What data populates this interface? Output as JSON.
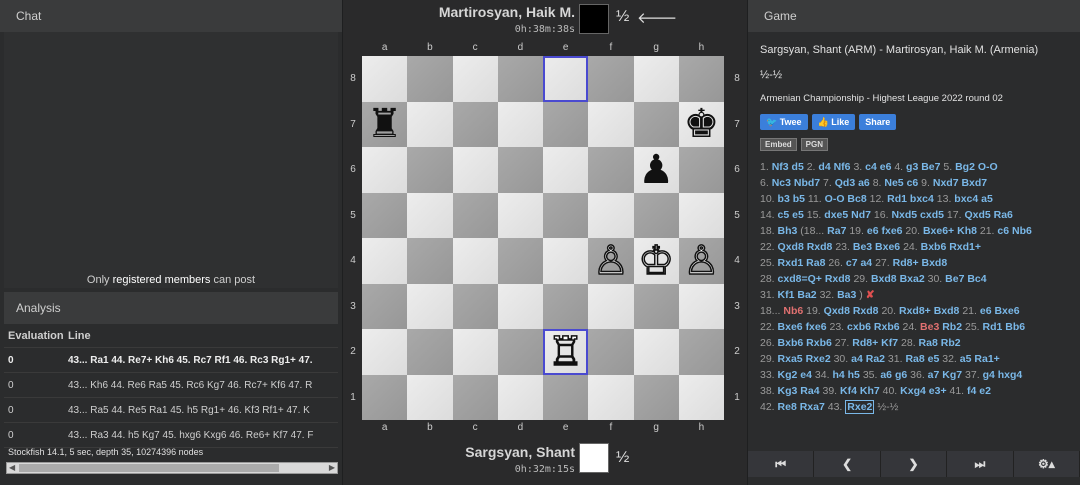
{
  "chat": {
    "title": "Chat",
    "note_prefix": "Only ",
    "note_link": "registered members",
    "note_suffix": " can post"
  },
  "analysis": {
    "title": "Analysis",
    "col_eval": "Evaluation",
    "col_line": "Line",
    "rows": [
      {
        "eval": "0",
        "line": "43... Ra1 44. Re7+ Kh6 45. Rc7 Rf1 46. Rc3 Rg1+ 47."
      },
      {
        "eval": "0",
        "line": "43... Kh6 44. Re6 Ra5 45. Rc6 Kg7 46. Rc7+ Kf6 47. R"
      },
      {
        "eval": "0",
        "line": "43... Ra5 44. Re5 Ra1 45. h5 Rg1+ 46. Kf3 Rf1+ 47. K"
      },
      {
        "eval": "0",
        "line": "43... Ra3 44. h5 Kg7 45. hxg6 Kxg6 46. Re6+ Kf7 47. F"
      }
    ],
    "engine_name": "Stockfish 14.1",
    "engine_info": ", 5 sec, depth 35, 10274396 nodes"
  },
  "top_player": {
    "name": "Martirosyan, Haik M.",
    "time": "0h:38m:38s",
    "score": "½",
    "arrow": "🡐",
    "color": "#000000"
  },
  "bottom_player": {
    "name": "Sargsyan, Shant",
    "time": "0h:32m:15s",
    "score": "½",
    "color": "#ffffff"
  },
  "board": {
    "files": [
      "a",
      "b",
      "c",
      "d",
      "e",
      "f",
      "g",
      "h"
    ],
    "ranks": [
      "8",
      "7",
      "6",
      "5",
      "4",
      "3",
      "2",
      "1"
    ],
    "pieces": {
      "a7": {
        "glyph": "♜",
        "side": "b"
      },
      "h7": {
        "glyph": "♚",
        "side": "b"
      },
      "g6": {
        "glyph": "♟",
        "side": "b"
      },
      "f4": {
        "glyph": "♙",
        "side": "w"
      },
      "g4": {
        "glyph": "♔",
        "side": "w"
      },
      "h4": {
        "glyph": "♙",
        "side": "w"
      },
      "e2": {
        "glyph": "♖",
        "side": "w"
      }
    },
    "highlight": [
      "e8",
      "e2"
    ]
  },
  "game": {
    "title": "Game",
    "players": "Sargsyan, Shant (ARM) - Martirosyan, Haik M. (Armenia)",
    "result": "½-½",
    "event": "Armenian Championship - Highest League 2022 round 02",
    "tweet": "Twee",
    "like": "Like",
    "share": "Share",
    "embed": "Embed",
    "pgn": "PGN",
    "move_lines": [
      [
        [
          "n",
          "1."
        ],
        [
          "m",
          "Nf3"
        ],
        [
          "m",
          "d5"
        ],
        [
          "n",
          "2."
        ],
        [
          "m",
          "d4"
        ],
        [
          "m",
          "Nf6"
        ],
        [
          "n",
          "3."
        ],
        [
          "m",
          "c4"
        ],
        [
          "m",
          "e6"
        ],
        [
          "n",
          "4."
        ],
        [
          "m",
          "g3"
        ],
        [
          "m",
          "Be7"
        ],
        [
          "n",
          "5."
        ],
        [
          "m",
          "Bg2"
        ],
        [
          "m",
          "O-O"
        ]
      ],
      [
        [
          "n",
          "6."
        ],
        [
          "m",
          "Nc3"
        ],
        [
          "m",
          "Nbd7"
        ],
        [
          "n",
          "7."
        ],
        [
          "m",
          "Qd3"
        ],
        [
          "m",
          "a6"
        ],
        [
          "n",
          "8."
        ],
        [
          "m",
          "Ne5"
        ],
        [
          "m",
          "c6"
        ],
        [
          "n",
          "9."
        ],
        [
          "m",
          "Nxd7"
        ],
        [
          "m",
          "Bxd7"
        ]
      ],
      [
        [
          "n",
          "10."
        ],
        [
          "m",
          "b3"
        ],
        [
          "m",
          "b5"
        ],
        [
          "n",
          "11."
        ],
        [
          "m",
          "O-O"
        ],
        [
          "m",
          "Bc8"
        ],
        [
          "n",
          "12."
        ],
        [
          "m",
          "Rd1"
        ],
        [
          "m",
          "bxc4"
        ],
        [
          "n",
          "13."
        ],
        [
          "m",
          "bxc4"
        ],
        [
          "m",
          "a5"
        ]
      ],
      [
        [
          "n",
          "14."
        ],
        [
          "m",
          "c5"
        ],
        [
          "m",
          "e5"
        ],
        [
          "n",
          "15."
        ],
        [
          "m",
          "dxe5"
        ],
        [
          "m",
          "Nd7"
        ],
        [
          "n",
          "16."
        ],
        [
          "m",
          "Nxd5"
        ],
        [
          "m",
          "cxd5"
        ],
        [
          "n",
          "17."
        ],
        [
          "m",
          "Qxd5"
        ],
        [
          "m",
          "Ra6"
        ]
      ],
      [
        [
          "n",
          "18."
        ],
        [
          "m",
          "Bh3"
        ],
        [
          "n",
          "(18..."
        ],
        [
          "m",
          "Ra7"
        ],
        [
          "n",
          "19."
        ],
        [
          "m",
          "e6"
        ],
        [
          "m",
          "fxe6"
        ],
        [
          "n",
          "20."
        ],
        [
          "m",
          "Bxe6+"
        ],
        [
          "m",
          "Kh8"
        ],
        [
          "n",
          "21."
        ],
        [
          "m",
          "c6"
        ],
        [
          "m",
          "Nb6"
        ]
      ],
      [
        [
          "n",
          "22."
        ],
        [
          "m",
          "Qxd8"
        ],
        [
          "m",
          "Rxd8"
        ],
        [
          "n",
          "23."
        ],
        [
          "m",
          "Be3"
        ],
        [
          "m",
          "Bxe6"
        ],
        [
          "n",
          "24."
        ],
        [
          "m",
          "Bxb6"
        ],
        [
          "m",
          "Rxd1+"
        ]
      ],
      [
        [
          "n",
          "25."
        ],
        [
          "m",
          "Rxd1"
        ],
        [
          "m",
          "Ra8"
        ],
        [
          "n",
          "26."
        ],
        [
          "m",
          "c7"
        ],
        [
          "m",
          "a4"
        ],
        [
          "n",
          "27."
        ],
        [
          "m",
          "Rd8+"
        ],
        [
          "m",
          "Bxd8"
        ]
      ],
      [
        [
          "n",
          "28."
        ],
        [
          "m",
          "cxd8=Q+"
        ],
        [
          "m",
          "Rxd8"
        ],
        [
          "n",
          "29."
        ],
        [
          "m",
          "Bxd8"
        ],
        [
          "m",
          "Bxa2"
        ],
        [
          "n",
          "30."
        ],
        [
          "m",
          "Be7"
        ],
        [
          "m",
          "Bc4"
        ]
      ],
      [
        [
          "n",
          "31."
        ],
        [
          "m",
          "Kf1"
        ],
        [
          "m",
          "Ba2"
        ],
        [
          "n",
          "32."
        ],
        [
          "m",
          "Ba3"
        ],
        [
          "n",
          ")"
        ],
        [
          "x",
          "✘"
        ]
      ],
      [
        [
          "n",
          "18..."
        ],
        [
          "r",
          "Nb6"
        ],
        [
          "n",
          "19."
        ],
        [
          "m",
          "Qxd8"
        ],
        [
          "m",
          "Rxd8"
        ],
        [
          "n",
          "20."
        ],
        [
          "m",
          "Rxd8+"
        ],
        [
          "m",
          "Bxd8"
        ],
        [
          "n",
          "21."
        ],
        [
          "m",
          "e6"
        ],
        [
          "m",
          "Bxe6"
        ]
      ],
      [
        [
          "n",
          "22."
        ],
        [
          "m",
          "Bxe6"
        ],
        [
          "m",
          "fxe6"
        ],
        [
          "n",
          "23."
        ],
        [
          "m",
          "cxb6"
        ],
        [
          "m",
          "Rxb6"
        ],
        [
          "n",
          "24."
        ],
        [
          "r",
          "Be3"
        ],
        [
          "m",
          "Rb2"
        ],
        [
          "n",
          "25."
        ],
        [
          "m",
          "Rd1"
        ],
        [
          "m",
          "Bb6"
        ]
      ],
      [
        [
          "n",
          "26."
        ],
        [
          "m",
          "Bxb6"
        ],
        [
          "m",
          "Rxb6"
        ],
        [
          "n",
          "27."
        ],
        [
          "m",
          "Rd8+"
        ],
        [
          "m",
          "Kf7"
        ],
        [
          "n",
          "28."
        ],
        [
          "m",
          "Ra8"
        ],
        [
          "m",
          "Rb2"
        ]
      ],
      [
        [
          "n",
          "29."
        ],
        [
          "m",
          "Rxa5"
        ],
        [
          "m",
          "Rxe2"
        ],
        [
          "n",
          "30."
        ],
        [
          "m",
          "a4"
        ],
        [
          "m",
          "Ra2"
        ],
        [
          "n",
          "31."
        ],
        [
          "m",
          "Ra8"
        ],
        [
          "m",
          "e5"
        ],
        [
          "n",
          "32."
        ],
        [
          "m",
          "a5"
        ],
        [
          "m",
          "Ra1+"
        ]
      ],
      [
        [
          "n",
          "33."
        ],
        [
          "m",
          "Kg2"
        ],
        [
          "m",
          "e4"
        ],
        [
          "n",
          "34."
        ],
        [
          "m",
          "h4"
        ],
        [
          "m",
          "h5"
        ],
        [
          "n",
          "35."
        ],
        [
          "m",
          "a6"
        ],
        [
          "m",
          "g6"
        ],
        [
          "n",
          "36."
        ],
        [
          "m",
          "a7"
        ],
        [
          "m",
          "Kg7"
        ],
        [
          "n",
          "37."
        ],
        [
          "m",
          "g4"
        ],
        [
          "m",
          "hxg4"
        ]
      ],
      [
        [
          "n",
          "38."
        ],
        [
          "m",
          "Kg3"
        ],
        [
          "m",
          "Ra4"
        ],
        [
          "n",
          "39."
        ],
        [
          "m",
          "Kf4"
        ],
        [
          "m",
          "Kh7"
        ],
        [
          "n",
          "40."
        ],
        [
          "m",
          "Kxg4"
        ],
        [
          "m",
          "e3+"
        ],
        [
          "n",
          "41."
        ],
        [
          "m",
          "f4"
        ],
        [
          "m",
          "e2"
        ]
      ],
      [
        [
          "n",
          "42."
        ],
        [
          "m",
          "Re8"
        ],
        [
          "m",
          "Rxa7"
        ],
        [
          "n",
          "43."
        ],
        [
          "c",
          "Rxe2"
        ],
        [
          "n",
          "½-½"
        ]
      ]
    ],
    "nav": {
      "first": "⏮",
      "prev": "❮",
      "next": "❯",
      "last": "⏭",
      "settings": "⚙▴"
    }
  }
}
